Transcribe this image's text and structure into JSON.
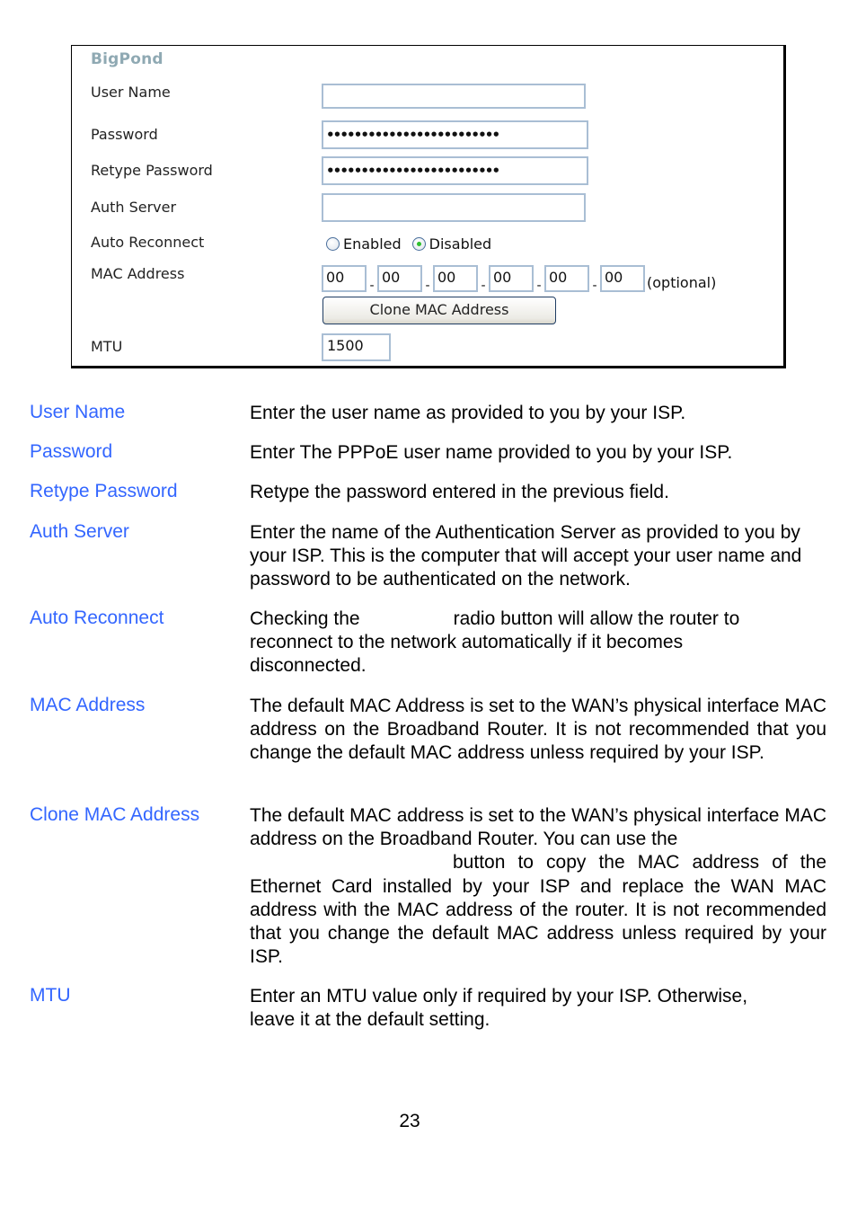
{
  "panel": {
    "title": "BigPond",
    "fields": {
      "user_name": {
        "label": "User Name",
        "value": ""
      },
      "password": {
        "label": "Password",
        "value": "•••••••••••••••••••••••••"
      },
      "retype_password": {
        "label": "Retype Password",
        "value": "•••••••••••••••••••••••••"
      },
      "auth_server": {
        "label": "Auth Server",
        "value": ""
      },
      "auto_reconnect": {
        "label": "Auto Reconnect",
        "options": [
          {
            "label": "Enabled",
            "selected": false
          },
          {
            "label": "Disabled",
            "selected": true
          }
        ],
        "accent_color": "#2fbf2f"
      },
      "mac_address": {
        "label": "MAC Address",
        "octets": [
          "00",
          "00",
          "00",
          "00",
          "00",
          "00"
        ],
        "separator": "-",
        "hint": "(optional)"
      },
      "clone_mac_button": "Clone MAC Address",
      "mtu": {
        "label": "MTU",
        "value": "1500"
      }
    }
  },
  "descriptions": {
    "term_color": "#3366ff",
    "items": [
      {
        "term": "User Name",
        "text": "Enter the user name as provided to you by your ISP."
      },
      {
        "term": "Password",
        "text": "Enter The PPPoE user name provided to you by your ISP."
      },
      {
        "term": "Retype Password",
        "text": "Retype the password entered in the previous field."
      },
      {
        "term": "Auth Server",
        "text": "Enter the name of the Authentication Server as provided to you by your ISP. This is the computer that will accept your user name and password to be authenticated on the network."
      },
      {
        "term": "Auto Reconnect",
        "text_before": "Checking the",
        "text_after": "radio button will allow the router to reconnect to the network automatically if it becomes disconnected."
      },
      {
        "term": "MAC Address",
        "text": "The default MAC Address is set to the WAN’s physical interface MAC address on the Broadband Router. It is not recommended that you change the default MAC address unless required by your ISP."
      },
      {
        "term": "Clone MAC Address",
        "text_before": "The default MAC address is set to the WAN’s physical interface MAC address on the Broadband Router. You can use the",
        "text_after": "button to copy the MAC address of the Ethernet Card installed by your ISP and replace the WAN MAC address with the MAC address of the router. It is not recommended that you change the default MAC address unless required by your ISP."
      },
      {
        "term": "MTU",
        "text": "Enter an MTU value only if required by your ISP. Otherwise, leave it at the default setting."
      }
    ]
  },
  "page_number": "23"
}
